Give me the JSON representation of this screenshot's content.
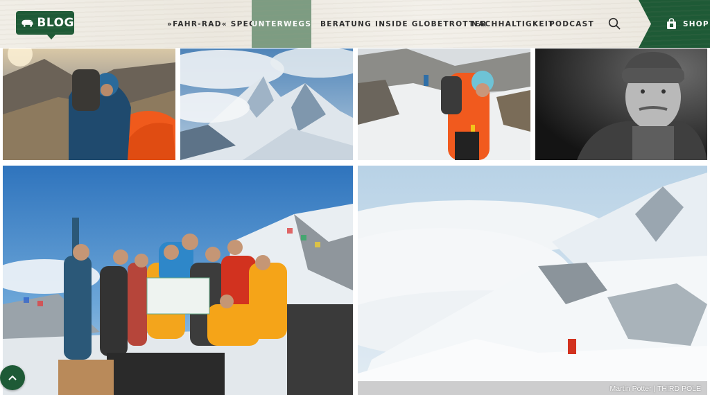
{
  "header": {
    "logo_text": "BLOG",
    "nav": [
      {
        "label": "»FAHR-RAD« SPECIAL",
        "active": false
      },
      {
        "label": "UNTERWEGS",
        "active": true
      },
      {
        "label": "BERATUNG",
        "active": false
      },
      {
        "label": "INSIDE GLOBETROTTER",
        "active": false
      },
      {
        "label": "NACHHALTIGKEIT",
        "active": false
      },
      {
        "label": "PODCAST",
        "active": false
      }
    ],
    "search_icon": "search-icon",
    "shop_label": "SHOP",
    "shop_icon": "shopping-bag-icon"
  },
  "gallery": {
    "photos": [
      {
        "subject": "climber-at-orange-tent"
      },
      {
        "subject": "snowy-mountain-peak-clouds"
      },
      {
        "subject": "hikers-on-snowy-trail"
      },
      {
        "subject": "portrait-man-beanie-bw"
      },
      {
        "subject": "group-summit-photo-prayer-flags"
      },
      {
        "subject": "snowy-ridge-above-sea-of-clouds"
      }
    ],
    "credit": "Martin Potter | THIRD POLE"
  },
  "scroll_top_icon": "chevron-up-icon",
  "colors": {
    "brand_green": "#1e5a36",
    "nav_active": "#7d9c82"
  }
}
